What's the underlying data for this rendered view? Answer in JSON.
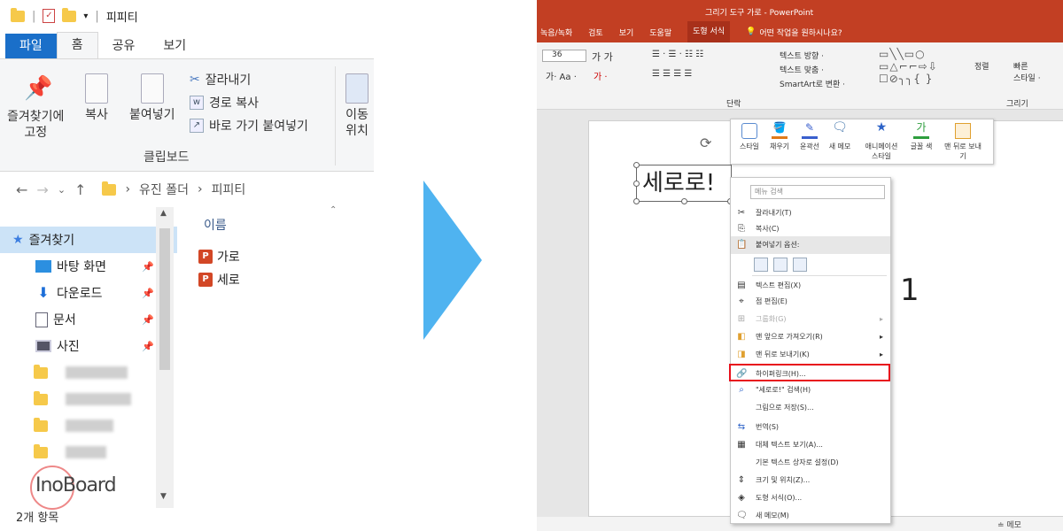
{
  "explorer": {
    "window_title": "피피티",
    "tabs": [
      "파일",
      "홈",
      "공유",
      "보기"
    ],
    "ribbon": {
      "pin_label_1": "즐겨찾기에",
      "pin_label_2": "고정",
      "copy_label": "복사",
      "paste_label": "붙여넣기",
      "cut_label": "잘라내기",
      "copy_path_label": "경로 복사",
      "paste_shortcut_label": "바로 가기 붙여넣기",
      "move_label_1": "이동",
      "move_label_2": "위치",
      "group_label": "클립보드"
    },
    "address": {
      "segments": [
        "유진 폴더",
        "피피티"
      ]
    },
    "nav": {
      "quick_access": "즐겨찾기",
      "items": [
        "바탕 화면",
        "다운로드",
        "문서",
        "사진"
      ]
    },
    "column_header": "이름",
    "files": [
      "가로",
      "세로"
    ],
    "status": "2개 항목",
    "logo_text": "InoBoard"
  },
  "ppt": {
    "title": "그리기 도구   가로 - PowerPoint",
    "tabs": [
      "녹음/녹화",
      "검토",
      "보기",
      "도움말",
      "도형 서식"
    ],
    "tell_me": "어떤 작업을 원하시나요?",
    "ribbon_groups": [
      "단락",
      "그리기"
    ],
    "ribbon_font_size": "36",
    "textbox_text": "세로로!",
    "mini_toolbar": [
      "스타일",
      "채우기",
      "윤곽선",
      "새 메모",
      "애니메이션 스타일",
      "글꼴 색",
      "맨 뒤로 보내기"
    ],
    "context_menu": {
      "search_placeholder": "메뉴 검색",
      "items": [
        {
          "label": "잘라내기(T)",
          "icon": "scissors-icon"
        },
        {
          "label": "복사(C)",
          "icon": "copy-icon"
        },
        {
          "label": "붙여넣기 옵션:",
          "icon": "paste-icon"
        },
        {
          "label": "텍스트 편집(X)",
          "icon": "edit-text-icon"
        },
        {
          "label": "점 편집(E)",
          "icon": "edit-points-icon"
        },
        {
          "label": "그룹화(G)",
          "icon": "group-icon"
        },
        {
          "label": "맨 앞으로 가져오기(R)",
          "icon": "bring-front-icon"
        },
        {
          "label": "맨 뒤로 보내기(K)",
          "icon": "send-back-icon"
        },
        {
          "label": "하이퍼링크(H)...",
          "icon": "hyperlink-icon"
        },
        {
          "label": "\"세로로!\" 검색(H)",
          "icon": "search-icon"
        },
        {
          "label": "그림으로 저장(S)...",
          "icon": ""
        },
        {
          "label": "번역(S)",
          "icon": "translate-icon"
        },
        {
          "label": "대체 텍스트 보기(A)...",
          "icon": "alt-text-icon"
        },
        {
          "label": "기본 텍스트 상자로 설정(D)",
          "icon": ""
        },
        {
          "label": "크기 및 위치(Z)...",
          "icon": "size-icon"
        },
        {
          "label": "도형 서식(O)...",
          "icon": "format-shape-icon"
        },
        {
          "label": "새 메모(M)",
          "icon": "comment-icon"
        }
      ]
    },
    "annotation_number": "1",
    "status_memo": "≐ 메모"
  },
  "colors": {
    "ppt_red": "#c23f23",
    "arrow_blue": "#4fb3f0",
    "highlight_red": "#e8101c",
    "file_tab_blue": "#1a6fc9"
  }
}
